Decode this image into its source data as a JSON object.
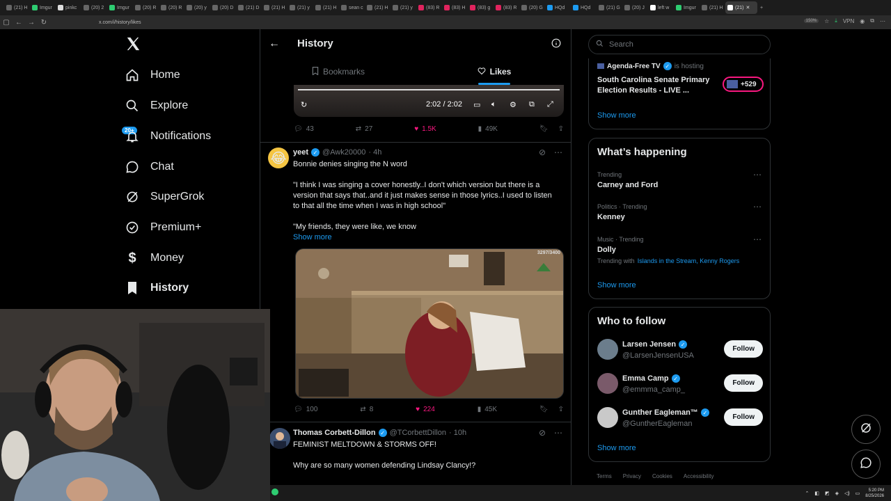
{
  "browser": {
    "tabs": [
      "(21) H",
      "Imgur",
      "pinkc",
      "(20) 2",
      "Imgur",
      "(20) R",
      "(20) R",
      "(20) y",
      "(20) D",
      "(21) D",
      "(21) H",
      "(21) y",
      "(21) H",
      "sean c",
      "(21) H",
      "(21) y",
      "(83) R",
      "(83) H",
      "(83) g",
      "(83) R",
      "(20) G",
      "HQd",
      "HQd",
      "(21) G",
      "(20) J",
      "left w",
      "Imgur",
      "(21) H",
      "(21)"
    ],
    "active_tab": "(21)",
    "url": "x.com/i/history/likes",
    "zoom": "150%",
    "vpn": "VPN"
  },
  "nav": {
    "items": [
      {
        "label": "Home"
      },
      {
        "label": "Explore"
      },
      {
        "label": "Notifications"
      },
      {
        "label": "Chat"
      },
      {
        "label": "SuperGrok"
      },
      {
        "label": "Premium+"
      },
      {
        "label": "Money"
      },
      {
        "label": "History"
      }
    ],
    "notif_badge": "20+"
  },
  "header": {
    "title": "History",
    "tabs": [
      {
        "label": "Bookmarks"
      },
      {
        "label": "Likes"
      }
    ]
  },
  "video1": {
    "time": "2:02 / 2:02",
    "actions": {
      "replies": "43",
      "reposts": "27",
      "likes": "1.5K",
      "views": "49K"
    }
  },
  "tweet2": {
    "name": "yeet",
    "handle": "@Awk20000",
    "time": "· 4h",
    "text1": "Bonnie denies singing the N word",
    "text2": "\"I think I was singing a cover honestly..I don't which version but there is a version that says that..and it just makes sense in those lyrics..I used to listen to that all the time when I was in high school\"",
    "text3": "\"My friends, they were like, we know",
    "show_more": "Show more",
    "video_counter": "3297/3400",
    "actions": {
      "replies": "100",
      "reposts": "8",
      "likes": "224",
      "views": "45K"
    }
  },
  "tweet3": {
    "name": "Thomas Corbett-Dillon",
    "handle": "@TCorbettDillon",
    "time": "· 10h",
    "text1": "FEMINIST MELTDOWN & STORMS OFF!",
    "text2": "Why are so many women defending Lindsay Clancy!?"
  },
  "right": {
    "search_placeholder": "Search",
    "live": {
      "host": "Agenda-Free TV",
      "host_suffix": "is hosting",
      "title": "South Carolina Senate Primary Election Results - LIVE ...",
      "badge": "+529",
      "show_more": "Show more"
    },
    "happening": {
      "title": "What’s happening",
      "trends": [
        {
          "meta": "Trending",
          "name": "Carney and Ford"
        },
        {
          "meta": "Politics · Trending",
          "name": "Kenney"
        },
        {
          "meta": "Music · Trending",
          "name": "Dolly",
          "extra_prefix": "Trending with",
          "extra_links": "Islands in the Stream, Kenny Rogers"
        }
      ],
      "show_more": "Show more"
    },
    "follow": {
      "title": "Who to follow",
      "users": [
        {
          "name": "Larsen Jensen",
          "handle": "@LarsenJensenUSA",
          "button": "Follow"
        },
        {
          "name": "Emma Camp",
          "handle": "@emmma_camp_",
          "button": "Follow"
        },
        {
          "name": "Gunther Eagleman™",
          "handle": "@GuntherEagleman",
          "button": "Follow"
        }
      ],
      "show_more": "Show more"
    },
    "footer": [
      "Terms",
      "Privacy",
      "Cookies",
      "Accessibility"
    ]
  },
  "taskbar": {
    "time": "5:20 PM",
    "date": "8/25/2026"
  },
  "colors": {
    "accent": "#1d9bf0",
    "like": "#f91880",
    "border": "#2f3336",
    "muted": "#71767b"
  }
}
